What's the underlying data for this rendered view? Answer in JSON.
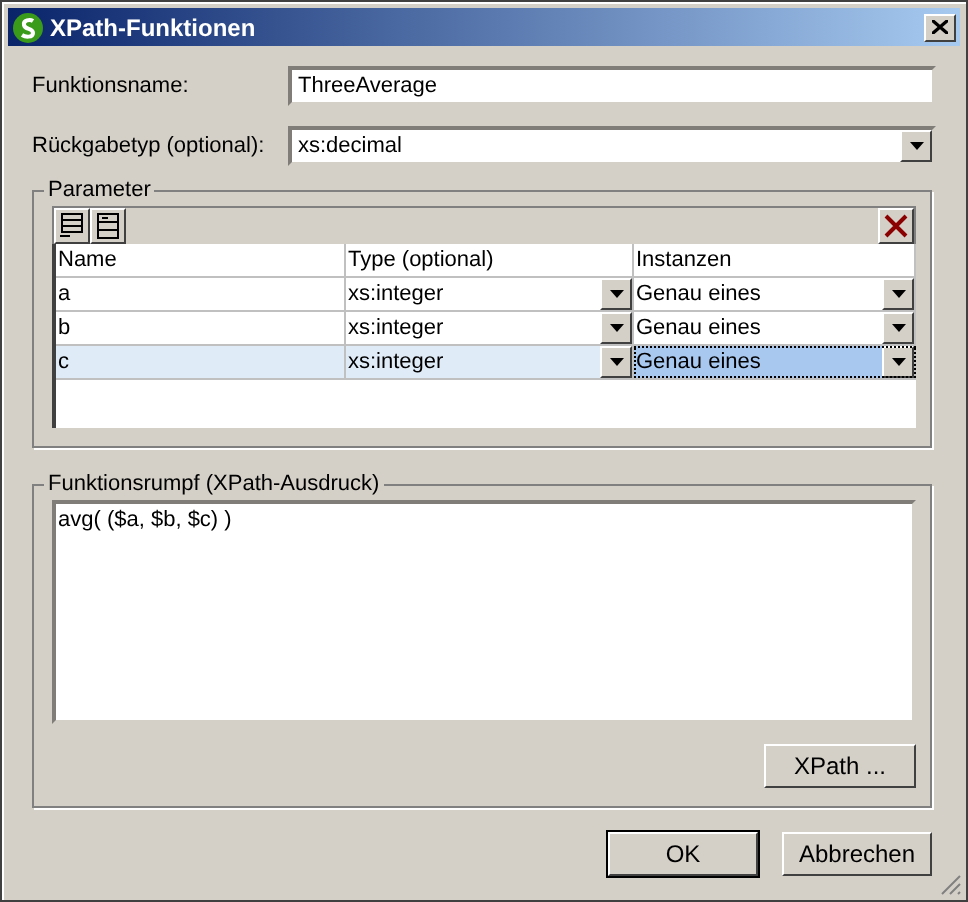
{
  "window": {
    "title": "XPath-Funktionen"
  },
  "function_name": {
    "label": "Funktionsname:",
    "value": "ThreeAverage"
  },
  "return_type": {
    "label": "Rückgabetyp (optional):",
    "value": "xs:decimal"
  },
  "parameters": {
    "title": "Parameter",
    "columns": [
      "Name",
      "Type (optional)",
      "Instanzen"
    ],
    "rows": [
      {
        "name": "a",
        "type": "xs:integer",
        "instances": "Genau eines",
        "selected": false
      },
      {
        "name": "b",
        "type": "xs:integer",
        "instances": "Genau eines",
        "selected": false
      },
      {
        "name": "c",
        "type": "xs:integer",
        "instances": "Genau eines",
        "selected": true
      }
    ]
  },
  "body": {
    "title": "Funktionsrumpf (XPath-Ausdruck)",
    "value": "avg( ($a, $b, $c) )",
    "button": "XPath ..."
  },
  "buttons": [
    {
      "label": "OK",
      "default": true
    },
    {
      "label": "Abbrechen",
      "default": false
    }
  ]
}
